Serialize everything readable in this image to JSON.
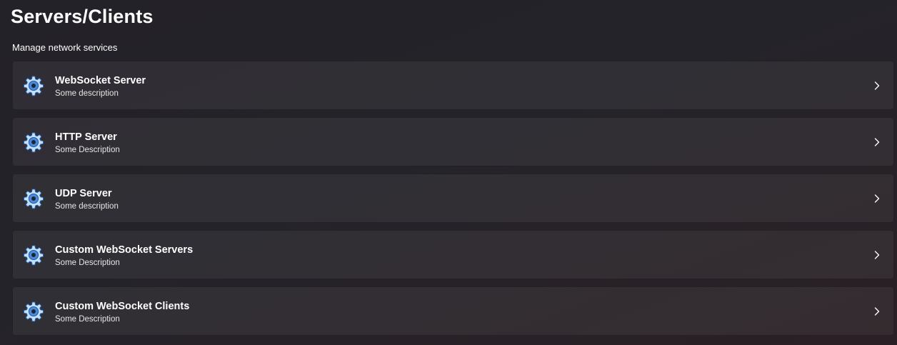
{
  "page": {
    "title": "Servers/Clients",
    "subtitle": "Manage network services"
  },
  "colors": {
    "icon_fill": "#4a8be0",
    "icon_light": "#c9e4ff",
    "icon_dark": "#1d3f73"
  },
  "services": [
    {
      "title": "WebSocket Server",
      "description": "Some description",
      "icon": "gear-icon"
    },
    {
      "title": "HTTP Server",
      "description": "Some Description",
      "icon": "gear-icon"
    },
    {
      "title": "UDP Server",
      "description": "Some description",
      "icon": "gear-icon"
    },
    {
      "title": "Custom WebSocket Servers",
      "description": "Some Description",
      "icon": "gear-icon"
    },
    {
      "title": "Custom WebSocket Clients",
      "description": "Some Description",
      "icon": "gear-icon"
    }
  ]
}
